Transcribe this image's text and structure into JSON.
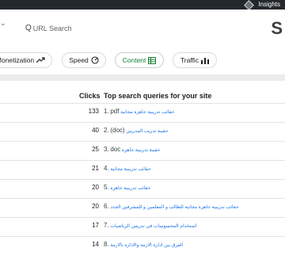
{
  "topbar": {
    "insights_label": "Insights"
  },
  "search": {
    "placeholder": "URL Search"
  },
  "logo_letter": "S",
  "tabs": [
    {
      "label": "Monetization",
      "icon": "trend-up-icon"
    },
    {
      "label": "Speed",
      "icon": "gauge-icon"
    },
    {
      "label": "Content",
      "icon": "table-icon",
      "active": true
    },
    {
      "label": "Traffic",
      "icon": "bar-chart-icon"
    }
  ],
  "table": {
    "clicks_header": "Clicks",
    "queries_header": "Top search queries for your site",
    "rows": [
      {
        "clicks": "133",
        "rank": "1.",
        "query": "حقائب تدريبية جاهزة مجانية",
        "latin": "pdf"
      },
      {
        "clicks": "40",
        "rank": "2.",
        "query": "حقيبة تدريب المدربين",
        "latin": "(doc)"
      },
      {
        "clicks": "25",
        "rank": "3.",
        "query": "حقيبة تدريبية جاهزة",
        "latin": "doc"
      },
      {
        "clicks": "21",
        "rank": "4.",
        "query": "حقائب تدريبية مجانية",
        "latin": ""
      },
      {
        "clicks": "20",
        "rank": "5.",
        "query": "حقائب تدريبية جاهزة",
        "latin": ""
      },
      {
        "clicks": "20",
        "rank": "6.",
        "query": "حقائب تدريبية جاهزة مجانية للطالب و المعلمين و للمشرفين الجدد",
        "latin": ""
      },
      {
        "clicks": "17",
        "rank": "7.",
        "query": "استخدام المحسوسات في تدريس الرياضيات",
        "latin": ""
      },
      {
        "clicks": "14",
        "rank": "8.",
        "query": "الفرق بين ادارة الازمة والادارة بالازمة",
        "latin": ""
      }
    ]
  }
}
